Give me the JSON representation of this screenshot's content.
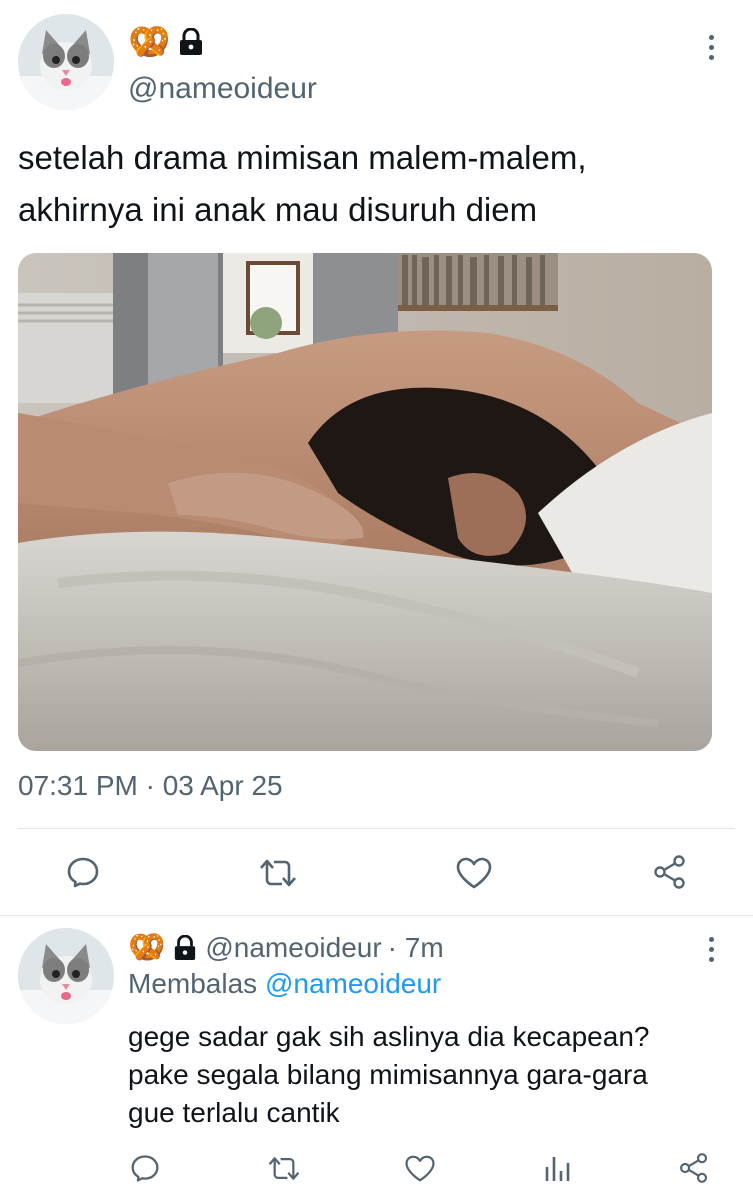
{
  "main_tweet": {
    "badge_emoji": "🥨",
    "handle": "@nameoideur",
    "text_line1": "setelah drama mimisan malem-malem,",
    "text_line2": "akhirnya ini anak mau disuruh diem",
    "timestamp": "07:31 PM · 03 Apr 25",
    "actions": [
      "reply-icon",
      "retweet-icon",
      "like-icon",
      "share-icon"
    ]
  },
  "reply_tweet": {
    "badge_emoji": "🥨",
    "handle": "@nameoideur",
    "time": "· 7m",
    "replying_prefix": "Membalas",
    "replying_to": "@nameoideur",
    "text_line1": "gege sadar gak sih aslinya dia kecapean?",
    "text_line2": "pake segala bilang mimisannya gara-gara",
    "text_line3": "gue terlalu cantik",
    "actions": [
      "reply-icon",
      "retweet-icon",
      "like-icon",
      "views-icon",
      "share-icon"
    ]
  },
  "colors": {
    "text": "#0f1419",
    "secondary": "#536471",
    "accent": "#1d9bf0",
    "divider": "#e1e5e8"
  }
}
